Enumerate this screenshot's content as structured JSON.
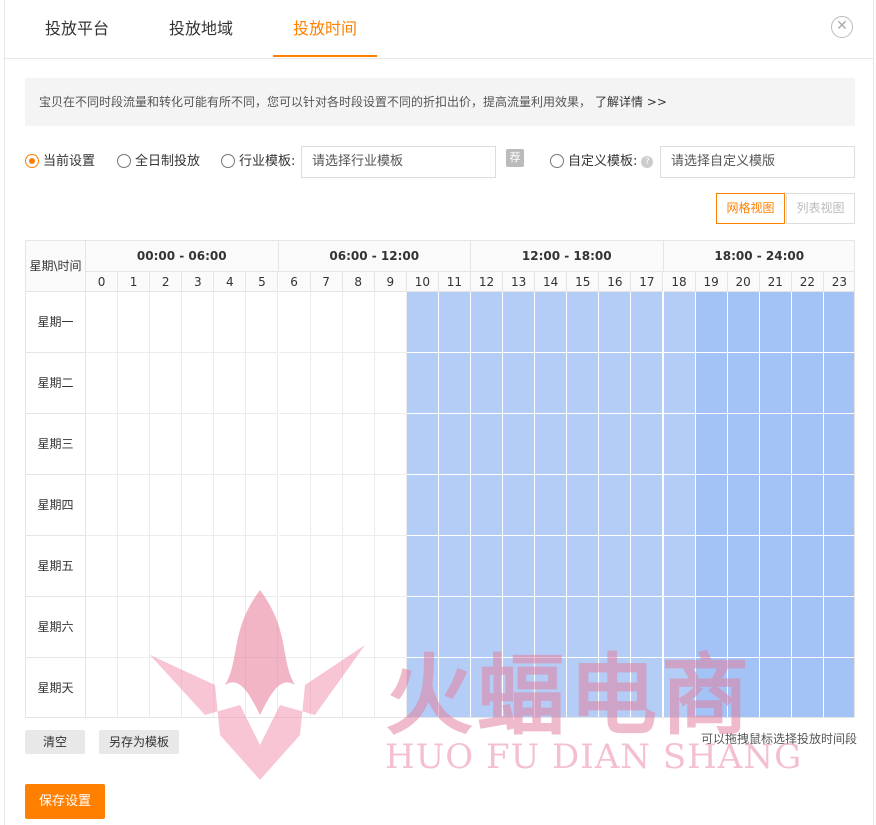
{
  "tabs": [
    {
      "label": "投放平台",
      "active": false
    },
    {
      "label": "投放地域",
      "active": false
    },
    {
      "label": "投放时间",
      "active": true
    }
  ],
  "close_icon": "close-icon",
  "notice": {
    "text": "宝贝在不同时段流量和转化可能有所不同，您可以针对各时段设置不同的折扣出价，提高流量利用效果，",
    "link": "了解详情 >>"
  },
  "options": {
    "current": "当前设置",
    "allday": "全日制投放",
    "industry": "行业模板:",
    "industry_placeholder": "请选择行业模板",
    "recommend_tag": "荐",
    "custom": "自定义模板:",
    "custom_placeholder": "请选择自定义模版",
    "selected": "current"
  },
  "views": {
    "grid": "网格视图",
    "list": "列表视图",
    "active": "grid"
  },
  "grid": {
    "corner": "星期\\时间",
    "ranges": [
      "00:00 - 06:00",
      "06:00 - 12:00",
      "12:00 - 18:00",
      "18:00 - 24:00"
    ],
    "hours": [
      "0",
      "1",
      "2",
      "3",
      "4",
      "5",
      "6",
      "7",
      "8",
      "9",
      "10",
      "11",
      "12",
      "13",
      "14",
      "15",
      "16",
      "17",
      "18",
      "19",
      "20",
      "21",
      "22",
      "23"
    ],
    "days": [
      "星期一",
      "星期二",
      "星期三",
      "星期四",
      "星期五",
      "星期六",
      "星期天"
    ],
    "active_hours_start": 10,
    "active_hours_end": 23,
    "peak_hours_start": 19,
    "peak_hours_end": 23,
    "colors": {
      "active": "#b3cdf7",
      "peak": "#a3c2f5",
      "accent": "#ff8000"
    }
  },
  "buttons": {
    "clear": "清空",
    "save_template": "另存为模板",
    "save": "保存设置"
  },
  "hint": "可以拖拽鼠标选择投放时间段",
  "watermark": {
    "cn": "火蝠电商",
    "en": "HUO FU DIAN SHANG",
    "logo": "flame-bat-logo"
  }
}
